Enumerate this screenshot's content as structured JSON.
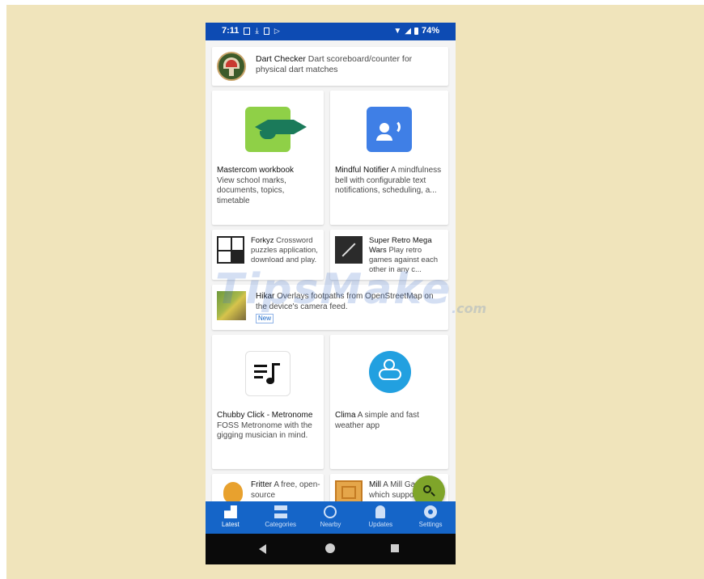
{
  "status": {
    "time": "7:11",
    "battery": "74%"
  },
  "apps": {
    "dart": {
      "name": "Dart Checker",
      "desc": " Dart scoreboard/counter for physical dart matches"
    },
    "mastercom": {
      "name": "Mastercom workbook",
      "desc": "View school marks, documents, topics, timetable"
    },
    "mindful": {
      "name": "Mindful Notifier",
      "desc": " A mindfulness bell with configurable text notifications, scheduling, a..."
    },
    "forkyz": {
      "name": "Forkyz",
      "desc": " Crossword puzzles application, download and play."
    },
    "retro": {
      "name": "Super Retro Mega Wars",
      "desc": " Play retro games against each other in any c..."
    },
    "hikar": {
      "name": "Hikar",
      "desc": " Overlays footpaths from OpenStreetMap on the device's camera feed.",
      "badge": "New"
    },
    "chubby": {
      "name": "Chubby Click - Metronome",
      "desc": "FOSS Metronome with the gigging musician in mind."
    },
    "clima": {
      "name": "Clima",
      "desc": " A simple and fast weather app"
    },
    "fritter": {
      "name": "Fritter",
      "desc": " A free, open-source"
    },
    "mill": {
      "name": "Mill",
      "desc": " A Mill Game which supports"
    }
  },
  "nav": [
    {
      "label": "Latest",
      "icon": "latest-icon"
    },
    {
      "label": "Categories",
      "icon": "categories-icon"
    },
    {
      "label": "Nearby",
      "icon": "nearby-icon"
    },
    {
      "label": "Updates",
      "icon": "updates-icon"
    },
    {
      "label": "Settings",
      "icon": "settings-icon"
    }
  ],
  "watermark": {
    "text": "TipsMake",
    "domain": ".com"
  },
  "colors": {
    "statusbar": "#0d4bb3",
    "navbar": "#1565c8",
    "fab": "#7fa52a",
    "background": "#f0e4bb"
  }
}
